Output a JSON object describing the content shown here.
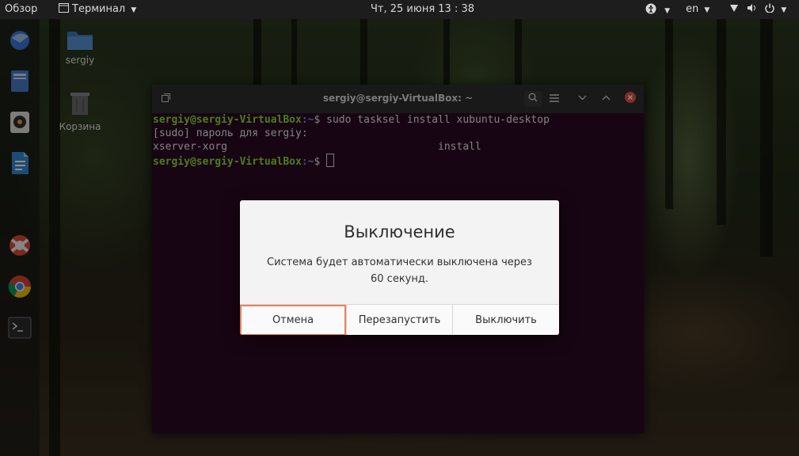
{
  "topbar": {
    "overview": "Обзор",
    "app_menu": "Терминал",
    "clock": "Чт, 25 июня  13 : 38",
    "language": "en"
  },
  "desktop": {
    "home_label": "sergiy",
    "trash_label": "Корзина"
  },
  "terminal": {
    "title": "sergiy@sergiy-VirtualBox: ~",
    "lines": {
      "l1_user": "sergiy@sergiy-VirtualBox",
      "l1_path": ":~",
      "l1_cmd": "$ sudo tasksel install xubuntu-desktop",
      "l2": "[sudo] пароль для sergiy:",
      "l3": "xserver-xorg                                  install",
      "l4_user": "sergiy@sergiy-VirtualBox",
      "l4_path": ":~",
      "l4_cmd": "$ "
    }
  },
  "dialog": {
    "title": "Выключение",
    "message": "Система будет автоматически выключена через 60 секунд.",
    "buttons": {
      "cancel": "Отмена",
      "restart": "Перезапустить",
      "power_off": "Выключить"
    }
  },
  "colors": {
    "prompt_user": "#8ae234",
    "prompt_path": "#729fcf",
    "focus_outline": "#e9825a"
  }
}
